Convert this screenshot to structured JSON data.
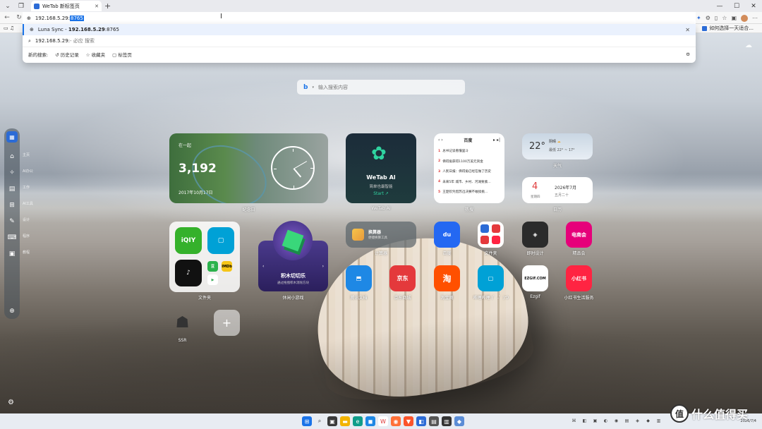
{
  "tab": {
    "title": "WeTab 新标签页"
  },
  "address": {
    "url_prefix": "192.168.5.29:",
    "url_selected": "8765"
  },
  "dropdown": {
    "suggestion_site": "Luna Sync",
    "suggestion_sep": " - ",
    "suggestion_host": "192.168.5.29",
    "suggestion_port": ":8765",
    "search_query": "192.168.5.29:",
    "search_suffix": " - 必应 搜索",
    "search_label": "新的搜索:",
    "history_label": "历史记录",
    "favorites_label": "收藏夹",
    "tabs_label": "标签页"
  },
  "bookmarks": {
    "right_item": "如何选择一天适合..."
  },
  "search": {
    "placeholder": "输入搜索内容"
  },
  "sidebar": {
    "items": [
      {
        "label": "主页",
        "icon": "home-icon"
      },
      {
        "label": "AI办公",
        "icon": "sparkle-icon"
      },
      {
        "label": "工作",
        "icon": "briefcase-icon"
      },
      {
        "label": "AI工具",
        "icon": "grid-icon"
      },
      {
        "label": "设计",
        "icon": "pen-icon"
      },
      {
        "label": "程序",
        "icon": "code-icon"
      },
      {
        "label": "教程",
        "icon": "book-icon"
      }
    ]
  },
  "widgets": {
    "anniversary": {
      "top": "在一起",
      "count": "3,192",
      "date": "2017年10月17日",
      "caption": "纪念日"
    },
    "wetab_ai": {
      "title": "WeTab AI",
      "subtitle": "简单也最智能",
      "cta": "Start ↗",
      "caption": "WeTab AI"
    },
    "hot": {
      "header": "百度",
      "items": [
        "总书记谈看懂里斗",
        "佛得角获得1100万美元资金",
        "人民日报：佛得角已经在做了历史",
        "未来5年 城市、乡村、河湖要素...",
        "王楚钦凭借苏迅决赛不敢搞挑..."
      ],
      "caption": "热搜"
    },
    "weather": {
      "temp": "22°",
      "desc": "阴晴",
      "range": "最低 22° ~ 17°",
      "caption": "天气"
    },
    "calendar": {
      "day": "4",
      "weekday": "星期四",
      "month": "2026年7月",
      "lunar": "五月二十",
      "caption": "日历"
    },
    "folder": {
      "caption": "文件夹"
    },
    "game": {
      "title": "积木切切乐",
      "subtitle": "通过拖拽积木消除方块",
      "caption": "休闲小游戏"
    },
    "tool": {
      "title": "换算器",
      "subtitle": "便捷换算工具",
      "caption": "计算器"
    }
  },
  "apps": [
    {
      "label": "百度",
      "text": "du",
      "color": "#2468f2"
    },
    {
      "label": "文件夹",
      "text": "",
      "color": "#ffffff"
    },
    {
      "label": "即时设计",
      "text": "",
      "color": "#2b2b2b"
    },
    {
      "label": "精品会",
      "text": "电商会",
      "color": "#e6007a"
    },
    {
      "label": "腾讯文档",
      "text": "",
      "color": "#1e88e5"
    },
    {
      "label": "京东商城",
      "text": "京东",
      "color": "#e4393c"
    },
    {
      "label": "淘宝网",
      "text": "淘",
      "color": "#ff5000"
    },
    {
      "label": "哔哩哔哩 (゜-゜)つ",
      "text": "",
      "color": "#00a1d6"
    },
    {
      "label": "Ezgif",
      "text": "EZGIF.COM",
      "color": "#ffffff"
    },
    {
      "label": "小红书生活服务",
      "text": "小红书",
      "color": "#ff2442"
    }
  ],
  "ssr": {
    "label": "SSR"
  },
  "folder_apps": {
    "iqiyi": "iQIY",
    "bili": "",
    "tiktok": "",
    "douban": "豆",
    "imdb": "IMDb",
    "play": "▶"
  },
  "brand": {
    "text": "什么值得买",
    "icon": "值"
  },
  "taskbar": {
    "time": "2026/7/4"
  }
}
